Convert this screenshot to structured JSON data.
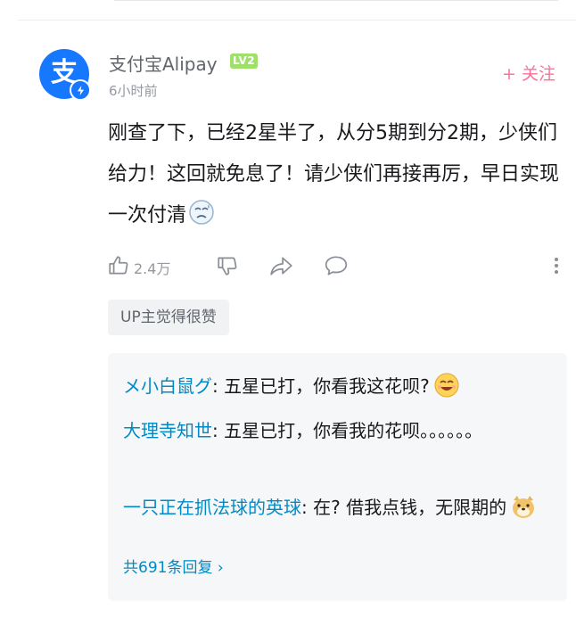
{
  "comment": {
    "username": "支付宝Alipay",
    "level": "LV2",
    "time": "6小时前",
    "follow_label": "+ 关注",
    "avatar_glyph": "支",
    "text": "刚查了下，已经2星半了，从分5期到分2期，少侠们给力！这回就免息了！请少侠们再接再厉，早日实现一次付清",
    "like_count": "2.4万",
    "up_liked_label": "UP主觉得很赞"
  },
  "replies": [
    {
      "name": "メ小白鼠グ",
      "text": ": 五星已打，你看我这花呗?"
    },
    {
      "name": "大理寺知世",
      "text": ": 五星已打，你看我的花呗。。。。。。"
    },
    {
      "name": "一只正在抓法球的英球",
      "text": ": 在? 借我点钱，无限期的"
    }
  ],
  "more_replies": "共691条回复 ›",
  "colors": {
    "accent_blue": "#008ac5",
    "follow_pink": "#fb7299",
    "level_green": "#9fe06a",
    "avatar_blue": "#1677ff"
  },
  "icons": [
    "thumbs-up-icon",
    "thumbs-down-icon",
    "share-icon",
    "comment-icon",
    "more-vertical-icon",
    "emoji-sweat-icon",
    "emoji-smile-icon",
    "emoji-doge-icon"
  ]
}
